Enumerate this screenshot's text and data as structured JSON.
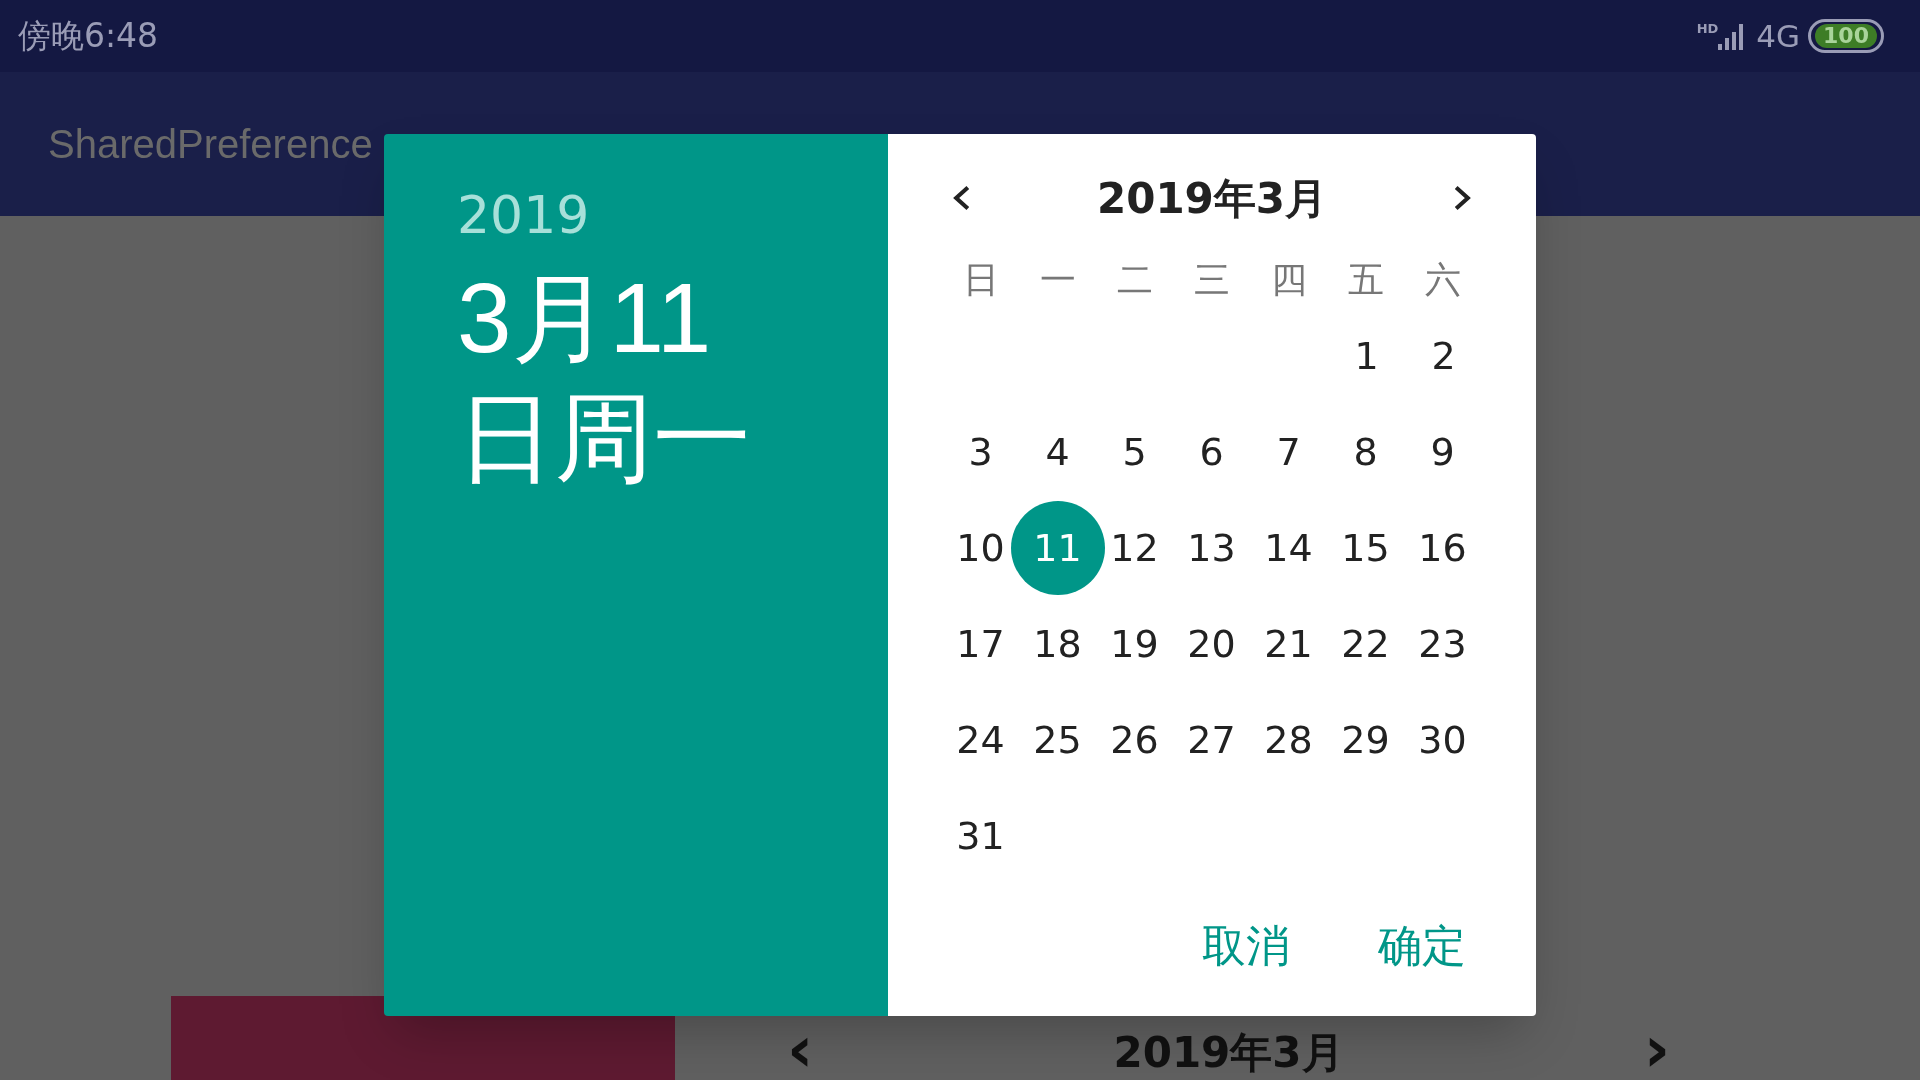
{
  "status_bar": {
    "time": "傍晚6:48",
    "network_badge": "HD",
    "network": "4G",
    "battery": "100"
  },
  "app_bar": {
    "title": "SharedPreference"
  },
  "background_picker": {
    "month_title": "2019年3月",
    "prev": "‹",
    "next": "›"
  },
  "dialog": {
    "year": "2019",
    "date": "3月11日周一",
    "month_title": "2019年3月",
    "weekdays": [
      "日",
      "一",
      "二",
      "三",
      "四",
      "五",
      "六"
    ],
    "weeks": [
      {
        "days": [
          {
            "label": "1",
            "selected": false
          },
          {
            "label": "2",
            "selected": false
          }
        ]
      },
      {
        "days": [
          {
            "label": "3",
            "selected": false
          },
          {
            "label": "4",
            "selected": false
          },
          {
            "label": "5",
            "selected": false
          },
          {
            "label": "6",
            "selected": false
          },
          {
            "label": "7",
            "selected": false
          },
          {
            "label": "8",
            "selected": false
          },
          {
            "label": "9",
            "selected": false
          }
        ]
      },
      {
        "days": [
          {
            "label": "10",
            "selected": false
          },
          {
            "label": "11",
            "selected": true
          },
          {
            "label": "12",
            "selected": false
          },
          {
            "label": "13",
            "selected": false
          },
          {
            "label": "14",
            "selected": false
          },
          {
            "label": "15",
            "selected": false
          },
          {
            "label": "16",
            "selected": false
          }
        ]
      },
      {
        "days": [
          {
            "label": "17",
            "selected": false
          },
          {
            "label": "18",
            "selected": false
          },
          {
            "label": "19",
            "selected": false
          },
          {
            "label": "20",
            "selected": false
          },
          {
            "label": "21",
            "selected": false
          },
          {
            "label": "22",
            "selected": false
          },
          {
            "label": "23",
            "selected": false
          }
        ]
      },
      {
        "days": [
          {
            "label": "24",
            "selected": false
          },
          {
            "label": "25",
            "selected": false
          },
          {
            "label": "26",
            "selected": false
          },
          {
            "label": "27",
            "selected": false
          },
          {
            "label": "28",
            "selected": false
          },
          {
            "label": "29",
            "selected": false
          },
          {
            "label": "30",
            "selected": false
          }
        ]
      },
      {
        "days": [
          {
            "label": "31",
            "selected": false
          }
        ]
      }
    ],
    "buttons": [
      "取消",
      "确定"
    ]
  }
}
